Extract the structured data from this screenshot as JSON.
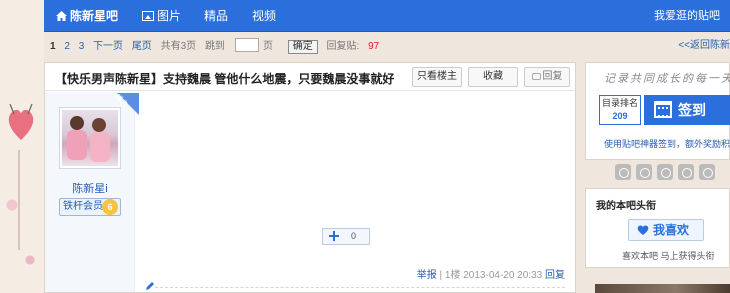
{
  "nav": {
    "home": "陈新星吧",
    "pics": "图片",
    "jingpin": "精品",
    "video": "视频",
    "fav": "我爱逛的贴吧"
  },
  "pager": {
    "pages": [
      "1",
      "2",
      "3"
    ],
    "next": "下一页",
    "last": "尾页",
    "total": "共有3页",
    "jump_label": "跳到",
    "jump_unit": "页",
    "ok": "确定",
    "reply_label": "回复贴:",
    "reply_count": "97",
    "back": "<<返回陈新"
  },
  "thread": {
    "title": "【快乐男声陈新星】支持魏晨 管他什么地震，只要魏晨没事就好",
    "only_lz": "只看楼主",
    "favorite": "收藏",
    "reply": "回复",
    "louzhu_tag": "楼主",
    "author": {
      "name": "陈新星i",
      "level_label": "铁杆会员",
      "level_num": "6"
    },
    "like_count": "0",
    "meta": {
      "report": "举报",
      "sep": "|",
      "floor": "1楼",
      "time": "2013-04-20 20:33",
      "reply": "回复"
    }
  },
  "sidebar": {
    "slogan": "记录共同成长的每一天",
    "rank_label": "目录排名",
    "rank_num": "209",
    "sign_label": "签到",
    "sign_tip": "使用贴吧神器签到，额外奖励积分",
    "head_title": "我的本吧头衔",
    "like_button": "我喜欢",
    "head_sub": "喜欢本吧  马上获得头衔"
  },
  "colors": {
    "nav_blue": "#2a6fdb",
    "link_blue": "#2a5db0",
    "reply_red": "#e02020"
  }
}
